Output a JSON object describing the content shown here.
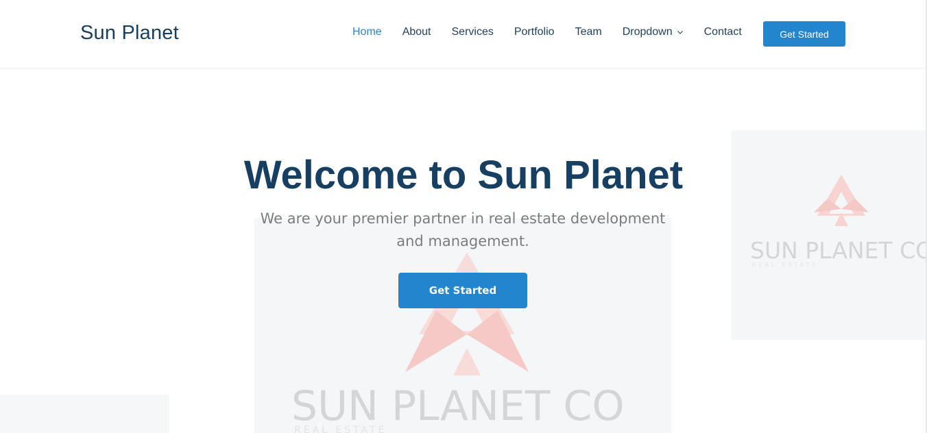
{
  "brand": {
    "name": "Sun Planet"
  },
  "nav": {
    "items": [
      {
        "label": "Home",
        "active": true
      },
      {
        "label": "About",
        "active": false
      },
      {
        "label": "Services",
        "active": false
      },
      {
        "label": "Portfolio",
        "active": false
      },
      {
        "label": "Team",
        "active": false
      },
      {
        "label": "Dropdown",
        "active": false,
        "has_dropdown": true,
        "icon": "chevron-down-icon"
      },
      {
        "label": "Contact",
        "active": false
      }
    ],
    "cta_label": "Get Started"
  },
  "hero": {
    "title": "Welcome to Sun Planet",
    "subtitle": "We are your premier partner in real estate development and management.",
    "cta_label": "Get Started"
  },
  "watermark": {
    "logo_text": "SUN PLANET CO",
    "logo_subtext": "REAL ESTATE",
    "logo_icon": "triangle-logo-icon"
  },
  "colors": {
    "primary": "#2385cd",
    "heading": "#163f62",
    "nav_text": "#1f3f5b",
    "nav_active": "#2f83c8",
    "subtitle": "#7a7d80",
    "watermark_accent": "#f4c9c6"
  }
}
